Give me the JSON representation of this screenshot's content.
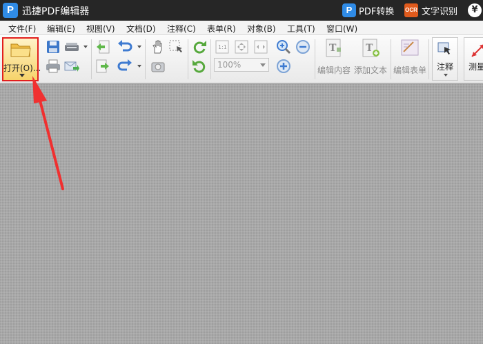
{
  "app": {
    "logo_letter": "P",
    "title": "迅捷PDF编辑器"
  },
  "titlebar_actions": {
    "pdf_convert": {
      "icon_letter": "P",
      "label": "PDF转换"
    },
    "ocr": {
      "icon_text": "OCR",
      "label": "文字识别"
    },
    "currency_icon": "¥"
  },
  "menu": [
    {
      "label": "文件(F)"
    },
    {
      "label": "编辑(E)"
    },
    {
      "label": "视图(V)"
    },
    {
      "label": "文档(D)"
    },
    {
      "label": "注释(C)"
    },
    {
      "label": "表单(R)"
    },
    {
      "label": "对象(B)"
    },
    {
      "label": "工具(T)"
    },
    {
      "label": "窗口(W)"
    }
  ],
  "toolbar": {
    "open_label": "打开(O)...",
    "zoom_value": "100%",
    "edit_content_label": "编辑内容",
    "add_text_label": "添加文本",
    "edit_form_label": "编辑表单",
    "annotate_label": "注释",
    "measure_label": "测量"
  },
  "colors": {
    "titlebar": "#262626",
    "highlight": "#e21e1e",
    "accent": "#2f8be6"
  }
}
